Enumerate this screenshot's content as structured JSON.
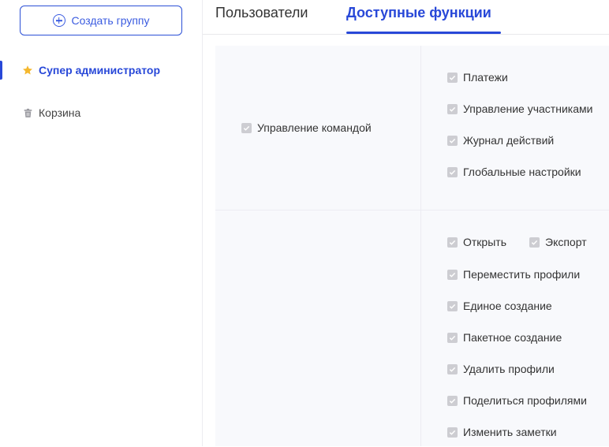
{
  "sidebar": {
    "create_group_label": "Создать группу",
    "items": [
      {
        "label": "Супер администратор",
        "icon": "star-icon",
        "active": true
      },
      {
        "label": "Корзина",
        "icon": "trash-icon",
        "active": false
      }
    ]
  },
  "tabs": [
    {
      "label": "Пользователи",
      "active": false
    },
    {
      "label": "Доступные функции",
      "active": true
    }
  ],
  "permissions": {
    "team": {
      "group_label": "Управление командой",
      "items": [
        "Платежи",
        "Управление участниками",
        "Журнал действий",
        "Глобальные настройки"
      ]
    },
    "profiles": {
      "items": [
        "Открыть",
        "Экспорт",
        "Переместить профили",
        "Единое создание",
        "Пакетное создание",
        "Удалить профили",
        "Поделиться профилями",
        "Изменить заметки"
      ]
    }
  },
  "colors": {
    "accent": "#2848d8",
    "star": "#f5b82e",
    "checkbox": "#cdcdd2",
    "table_bg": "#f8f9fc"
  }
}
